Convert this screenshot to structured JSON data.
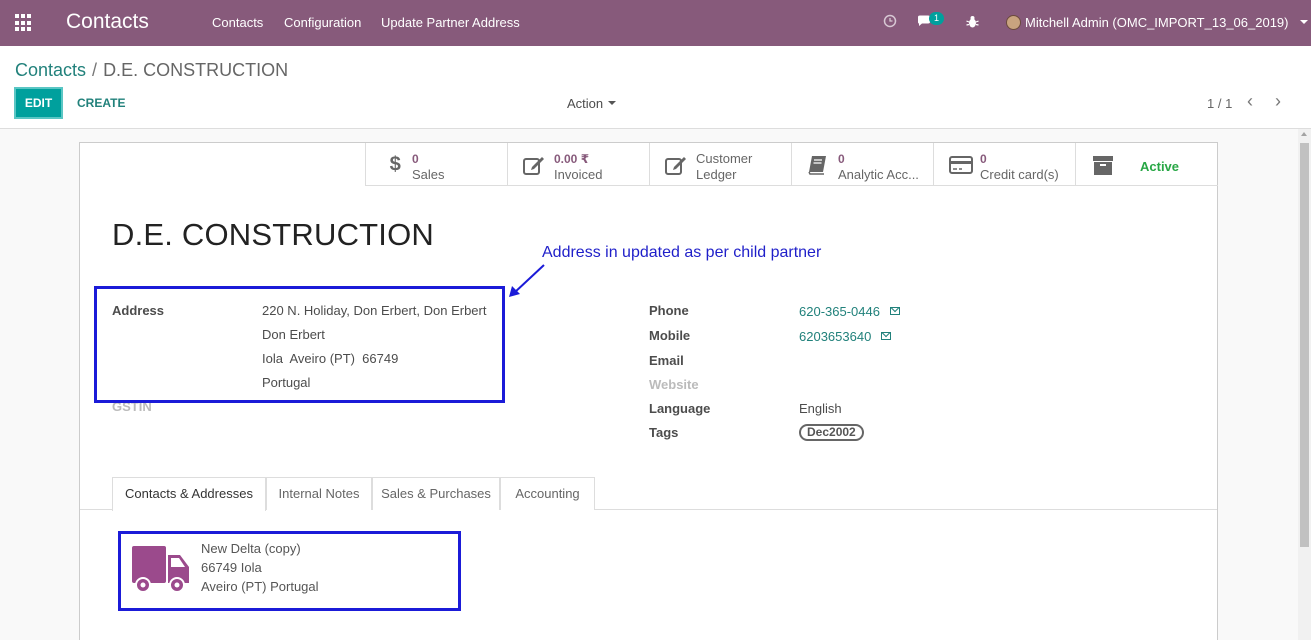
{
  "navbar": {
    "brand": "Contacts",
    "menu": [
      "Contacts",
      "Configuration",
      "Update Partner Address"
    ],
    "chat_badge": "1",
    "user": "Mitchell Admin (OMC_IMPORT_13_06_2019)",
    "bg_color": "#875a7b"
  },
  "control": {
    "breadcrumb_parent": "Contacts",
    "breadcrumb_current": "D.E. CONSTRUCTION",
    "edit_label": "EDIT",
    "create_label": "CREATE",
    "action_label": "Action",
    "pager": "1 / 1",
    "accent_color": "#00a09d"
  },
  "smart_buttons": {
    "sales_value": "0",
    "sales_label": "Sales",
    "invoiced_value": "0.00 ₹",
    "invoiced_label": "Invoiced",
    "ledger_line1": "Customer",
    "ledger_line2": "Ledger",
    "analytic_value": "0",
    "analytic_label": "Analytic Acc...",
    "credit_value": "0",
    "credit_label": "Credit card(s)",
    "active_label": "Active"
  },
  "partner": {
    "name": "D.E. CONSTRUCTION",
    "address_label": "Address",
    "address_lines": [
      "220 N. Holiday, Don Erbert, Don Erbert",
      "Don Erbert",
      "Iola  Aveiro (PT)  66749",
      "Portugal"
    ],
    "gstin_label": "GSTIN",
    "phone_label": "Phone",
    "phone": "620-365-0446",
    "mobile_label": "Mobile",
    "mobile": "6203653640",
    "email_label": "Email",
    "website_label": "Website",
    "language_label": "Language",
    "language": "English",
    "tags_label": "Tags",
    "tag": "Dec2002"
  },
  "annotation": "Address in updated as per child partner",
  "tabs": [
    "Contacts & Addresses",
    "Internal Notes",
    "Sales & Purchases",
    "Accounting"
  ],
  "child_contact": {
    "name": "New Delta (copy)",
    "line1": "66749 Iola",
    "line2": "Aveiro (PT) Portugal",
    "icon_color": "#9b4a8c"
  }
}
